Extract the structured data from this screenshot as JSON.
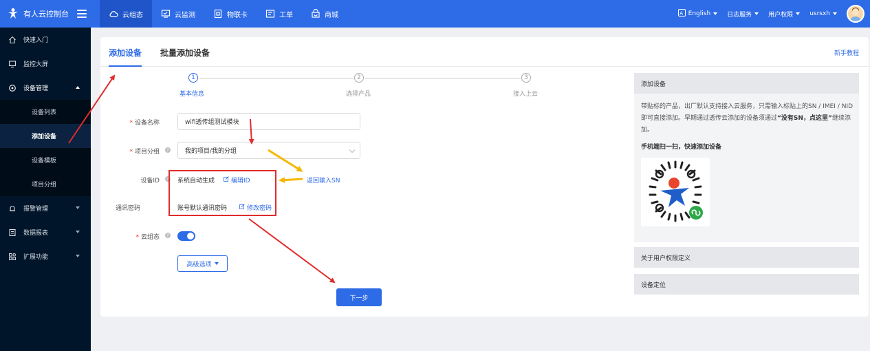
{
  "topbar": {
    "brand": "有人云控制台",
    "tabs": [
      {
        "label": "云组态",
        "icon": "cloud-icon",
        "active": true
      },
      {
        "label": "云监测",
        "icon": "monitor-icon"
      },
      {
        "label": "物联卡",
        "icon": "sim-card-icon"
      },
      {
        "label": "工单",
        "icon": "ticket-icon"
      },
      {
        "label": "商城",
        "icon": "shop-icon"
      }
    ],
    "language": "English",
    "log_service": "日志服务",
    "user_permission": "用户权限",
    "username": "usrsxh"
  },
  "sidebar": {
    "items": [
      {
        "label": "快速入门",
        "icon": "home-icon"
      },
      {
        "label": "监控大屏",
        "icon": "screen-icon"
      },
      {
        "label": "设备管理",
        "icon": "device-icon"
      }
    ],
    "sub_items": [
      {
        "label": "设备列表"
      },
      {
        "label": "添加设备",
        "active": true
      },
      {
        "label": "设备模板"
      },
      {
        "label": "项目分组"
      }
    ],
    "bottom_items": [
      {
        "label": "报警管理",
        "icon": "alarm-icon"
      },
      {
        "label": "数据报表",
        "icon": "report-icon"
      },
      {
        "label": "扩展功能",
        "icon": "extension-icon"
      }
    ]
  },
  "main": {
    "tabs": [
      "添加设备",
      "批量添加设备"
    ],
    "help_link": "新手教程",
    "steps": [
      {
        "num": "1",
        "label": "基本信息"
      },
      {
        "num": "2",
        "label": "选择产品"
      },
      {
        "num": "3",
        "label": "接入上云"
      }
    ],
    "form": {
      "device_name_label": "设备名称",
      "device_name_value": "wifi透传组测试模块",
      "project_group_label": "项目分组",
      "project_group_value": "我的项目/我的分组",
      "device_id_label": "设备ID",
      "device_id_value": "系统自动生成",
      "edit_id_link": "编辑ID",
      "return_sn_link": "返回输入SN",
      "comm_password_label": "通讯密码",
      "comm_password_value": "账号默认通讯密码",
      "modify_password_link": "修改密码",
      "cloud_config_label": "云组态",
      "advanced_button": "高级选项",
      "next_button": "下一步"
    }
  },
  "right_panel": {
    "add_device_title": "添加设备",
    "description": "带贴标的产品，出厂默认支持接入云服务，只需输入标贴上的SN / IMEI / NID 即可直接添加。早期通过透传云添加的设备须通过",
    "description_bold": "“没有SN，点这里”",
    "description_tail": "继续添加。",
    "qr_caption": "手机端扫一扫，快速添加设备",
    "permission_title": "关于用户权限定义",
    "location_title": "设备定位"
  },
  "colors": {
    "primary": "#2e6be6",
    "sidebar_bg": "#001529",
    "annotation_red": "#e02b2b",
    "annotation_yellow": "#f5b700"
  }
}
